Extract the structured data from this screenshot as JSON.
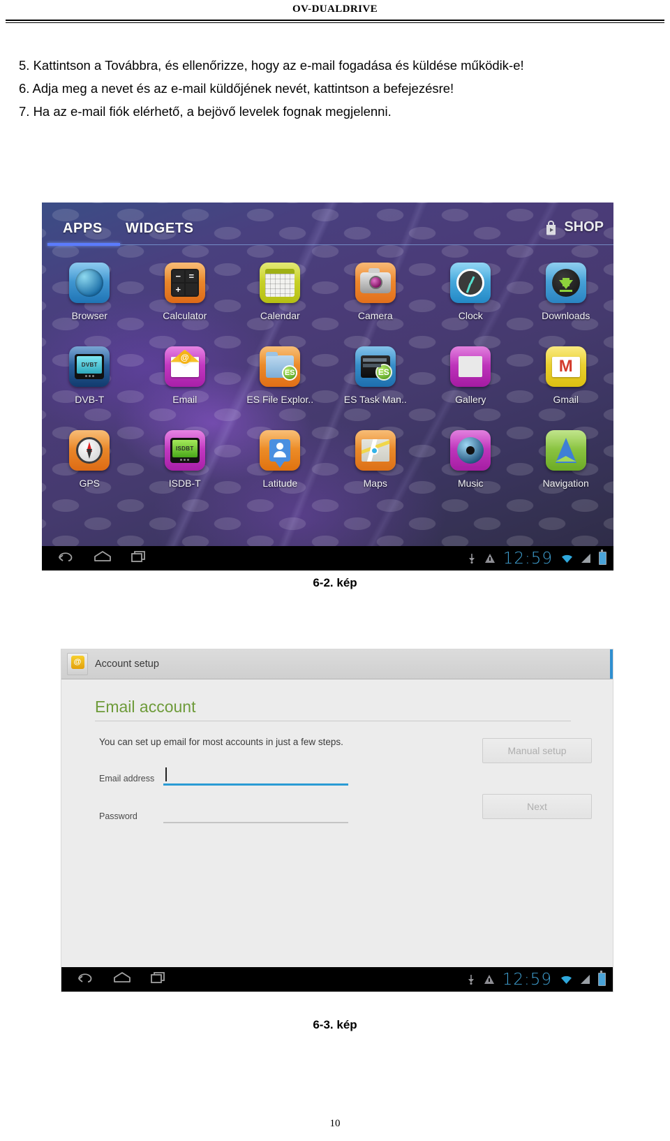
{
  "document": {
    "header_title": "OV-DUALDRIVE",
    "page_number": "10",
    "paragraphs": [
      "5. Kattintson a Továbbra, és ellenőrizze, hogy az e-mail fogadása és küldése működik-e!",
      "6. Adja meg a nevet és az e-mail küldőjének nevét, kattintson a befejezésre!",
      "7. Ha az e-mail fiók elérhető, a bejövő levelek fognak megjelenni."
    ],
    "figure_captions": {
      "figure1": "6-2. kép",
      "figure2": "6-3. kép"
    }
  },
  "app_drawer": {
    "tabs": [
      {
        "label": "APPS",
        "active": true
      },
      {
        "label": "WIDGETS",
        "active": false
      }
    ],
    "shop_label": "SHOP",
    "shop_icon": "shop-bag-icon",
    "apps": [
      {
        "label": "Browser",
        "icon": "browser-globe-icon"
      },
      {
        "label": "Calculator",
        "icon": "calculator-icon"
      },
      {
        "label": "Calendar",
        "icon": "calendar-icon"
      },
      {
        "label": "Camera",
        "icon": "camera-icon"
      },
      {
        "label": "Clock",
        "icon": "clock-icon"
      },
      {
        "label": "Downloads",
        "icon": "downloads-icon"
      },
      {
        "label": "DVB-T",
        "icon": "dvbt-tuner-icon"
      },
      {
        "label": "Email",
        "icon": "email-envelope-icon"
      },
      {
        "label": "ES File Explor..",
        "icon": "es-file-explorer-icon"
      },
      {
        "label": "ES Task Man..",
        "icon": "es-task-manager-icon"
      },
      {
        "label": "Gallery",
        "icon": "gallery-photo-icon"
      },
      {
        "label": "Gmail",
        "icon": "gmail-icon"
      },
      {
        "label": "GPS",
        "icon": "gps-compass-icon"
      },
      {
        "label": "ISDB-T",
        "icon": "isdbt-tuner-icon"
      },
      {
        "label": "Latitude",
        "icon": "latitude-pin-icon"
      },
      {
        "label": "Maps",
        "icon": "maps-icon"
      },
      {
        "label": "Music",
        "icon": "music-speaker-icon"
      },
      {
        "label": "Navigation",
        "icon": "navigation-arrow-icon"
      }
    ],
    "icon_glyphs": {
      "calculator": {
        "minus": "−",
        "equals": "=",
        "plus": "+",
        "blank": ""
      },
      "dvbt_screen_text": "DVBT",
      "isdbt_screen_text": "ISDBT",
      "email_at": "@",
      "es_badge": "ES",
      "gmail_letter": "M"
    }
  },
  "system_bar": {
    "back_icon": "back-arrow-icon",
    "home_icon": "home-icon",
    "recents_icon": "recent-apps-icon",
    "usb_icon": "usb-debug-icon",
    "warning_icon": "warning-triangle-icon",
    "clock": "12:59",
    "wifi_icon": "wifi-icon",
    "signal_icon": "signal-icon",
    "battery_icon": "battery-icon"
  },
  "account_setup": {
    "window_title": "Account setup",
    "window_icon": "email-account-icon",
    "heading": "Email account",
    "subtitle": "You can set up email for most accounts in just a few steps.",
    "fields": [
      {
        "label": "Email address",
        "value": "",
        "focused": true
      },
      {
        "label": "Password",
        "value": "",
        "focused": false
      }
    ],
    "buttons": [
      {
        "label": "Manual setup",
        "enabled": false
      },
      {
        "label": "Next",
        "enabled": false
      }
    ]
  },
  "colors": {
    "heading_green": "#6e9b3a",
    "focus_blue": "#2a9bd4",
    "status_clock_blue": "#3f9fd0",
    "tab_active_blue": "#5b7bff"
  }
}
